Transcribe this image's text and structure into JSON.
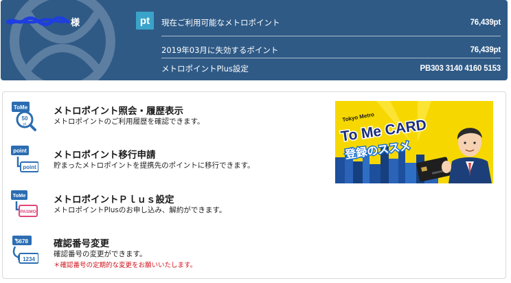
{
  "user": {
    "honorific": "様"
  },
  "header": {
    "badge": "pt",
    "rows": [
      {
        "label": "現在ご利用可能なメトロポイント",
        "value": "76,439pt"
      },
      {
        "label": "2019年03月に失効するポイント",
        "value": "76,439pt"
      },
      {
        "label": "メトロポイントPlus設定",
        "value": "PB303 3140 4160 5153"
      }
    ]
  },
  "menu": [
    {
      "title": "メトロポイント照会・履歴表示",
      "desc": "メトロポイントのご利用履歴を確認できます。",
      "icon": "tome-50pt-search-icon"
    },
    {
      "title": "メトロポイント移行申請",
      "desc": "貯まったメトロポイントを提携先のポイントに移行できます。",
      "icon": "point-transfer-icon"
    },
    {
      "title": "メトロポイントＰｌｕｓ設定",
      "desc": "メトロポイントPlusのお申し込み、解約ができます。",
      "icon": "tome-pasmo-icon"
    },
    {
      "title": "確認番号変更",
      "desc": "確認番号の変更ができます。",
      "note": "＊確認番号の定期的な変更をお願いいたします。",
      "icon": "pin-change-icon"
    }
  ],
  "banner": {
    "brand": "Tokyo Metro",
    "headline": "To Me CARD",
    "sub": "登録のススメ"
  },
  "colors": {
    "header_bg": "#2f5a86",
    "badge_bg": "#3aa3c9",
    "note_red": "#d0121b",
    "icon_blue": "#2b6db2",
    "banner_yellow": "#f6d800"
  }
}
